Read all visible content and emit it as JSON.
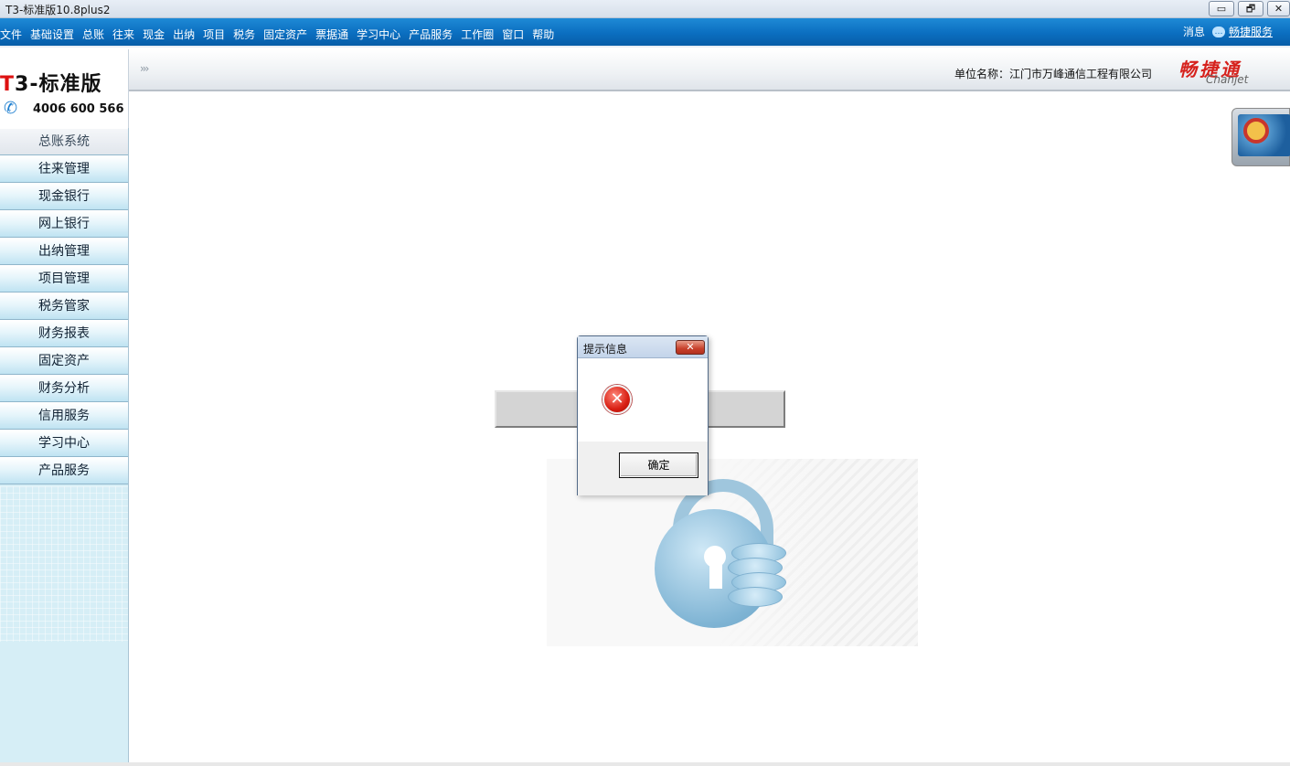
{
  "window": {
    "title": "T3-标准版10.8plus2",
    "min_label": "▭",
    "max_label": "🗗",
    "close_label": "✕"
  },
  "menu": {
    "items": [
      "文件",
      "基础设置",
      "总账",
      "往来",
      "现金",
      "出纳",
      "项目",
      "税务",
      "固定资产",
      "票据通",
      "学习中心",
      "产品服务",
      "工作圈",
      "窗口",
      "帮助"
    ],
    "messages_label": "消息",
    "service_link": "畅捷服务"
  },
  "logo": {
    "brand_t": "T",
    "brand_rest": "3-标准版",
    "phone": "4006 600 566"
  },
  "sidebar": {
    "items": [
      "总账系统",
      "往来管理",
      "现金银行",
      "网上银行",
      "出纳管理",
      "项目管理",
      "税务管家",
      "财务报表",
      "固定资产",
      "财务分析",
      "信用服务",
      "学习中心",
      "产品服务"
    ],
    "active_index": 0
  },
  "header": {
    "chevron": "›››",
    "unit_label": "单位名称：江门市万峰通信工程有限公司",
    "brand_cn": "畅捷通",
    "brand_en": "Chanjet"
  },
  "dialog": {
    "title": "提示信息",
    "close_label": "✕",
    "icon": "error-icon",
    "ok_label": "确定"
  },
  "colors": {
    "menubar": "#0b6ec0",
    "sidebar": "#d6eef6",
    "brand_red": "#d6221d"
  }
}
